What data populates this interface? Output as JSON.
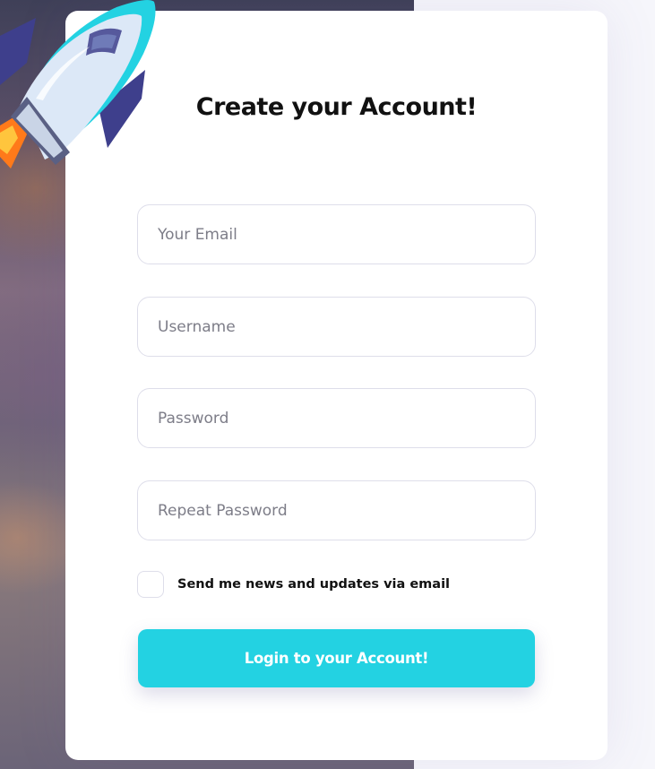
{
  "form": {
    "title": "Create your Account!",
    "email_placeholder": "Your Email",
    "username_placeholder": "Username",
    "password_placeholder": "Password",
    "repeat_password_placeholder": "Repeat Password",
    "newsletter_label": "Send me news and updates via email",
    "newsletter_checked": false,
    "submit_label": "Login to your Account!"
  },
  "colors": {
    "accent": "#23d2e2",
    "rocket_body": "#dce8f7",
    "rocket_fins": "#3e3f8c",
    "flame": "#ff7a1a"
  },
  "icons": {
    "decoration": "rocket-icon"
  }
}
